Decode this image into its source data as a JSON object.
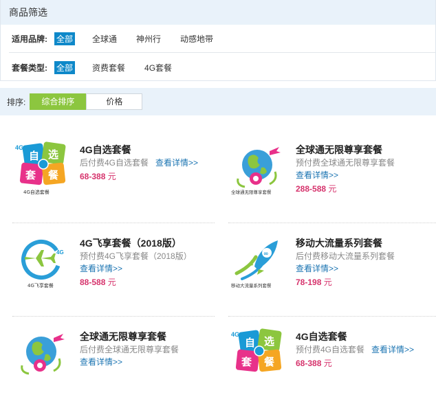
{
  "filter": {
    "title": "商品筛选",
    "brand_label": "适用品牌:",
    "brand_options": [
      "全部",
      "全球通",
      "神州行",
      "动感地带"
    ],
    "type_label": "套餐类型:",
    "type_options": [
      "全部",
      "资费套餐",
      "4G套餐"
    ]
  },
  "sort": {
    "label": "排序:",
    "options": [
      "综合排序",
      "价格"
    ]
  },
  "products": [
    {
      "name": "4G自选套餐",
      "desc": "后付费4G自选套餐",
      "more": "查看详情>>",
      "price": "68-388",
      "unit": "元",
      "icon_caption": "4G自选套餐",
      "icon": "4g-self-select-icon",
      "inline_more": true
    },
    {
      "name": "全球通无限尊享套餐",
      "desc": "预付费全球通无限尊享套餐",
      "more": "查看详情>>",
      "price": "288-588",
      "unit": "元",
      "icon_caption": "全球通无限尊享套餐",
      "icon": "globe-icon",
      "inline_more": false
    },
    {
      "name": "4G飞享套餐（2018版）",
      "desc": "预付费4G飞享套餐（2018版）",
      "more": "查看详情>>",
      "price": "88-588",
      "unit": "元",
      "icon_caption": "4G飞享套餐",
      "icon": "airplane-icon",
      "inline_more": false
    },
    {
      "name": "移动大流量系列套餐",
      "desc": "后付费移动大流量系列套餐",
      "more": "查看详情>>",
      "price": "78-198",
      "unit": "元",
      "icon_caption": "移动大流量系列套餐",
      "icon": "rocket-icon",
      "inline_more": false
    },
    {
      "name": "全球通无限尊享套餐",
      "desc": "后付费全球通无限尊享套餐",
      "more": "查看详情>>",
      "price": "",
      "unit": "",
      "icon_caption": "",
      "icon": "globe-icon",
      "inline_more": false
    },
    {
      "name": "4G自选套餐",
      "desc": "预付费4G自选套餐",
      "more": "查看详情>>",
      "price": "68-388",
      "unit": "元",
      "icon_caption": "",
      "icon": "4g-self-select-icon",
      "inline_more": true
    }
  ],
  "colors": {
    "accent_blue": "#0e88c9",
    "active_green": "#8cc63f",
    "price_red": "#d6336c",
    "link_blue": "#1b74b2"
  }
}
